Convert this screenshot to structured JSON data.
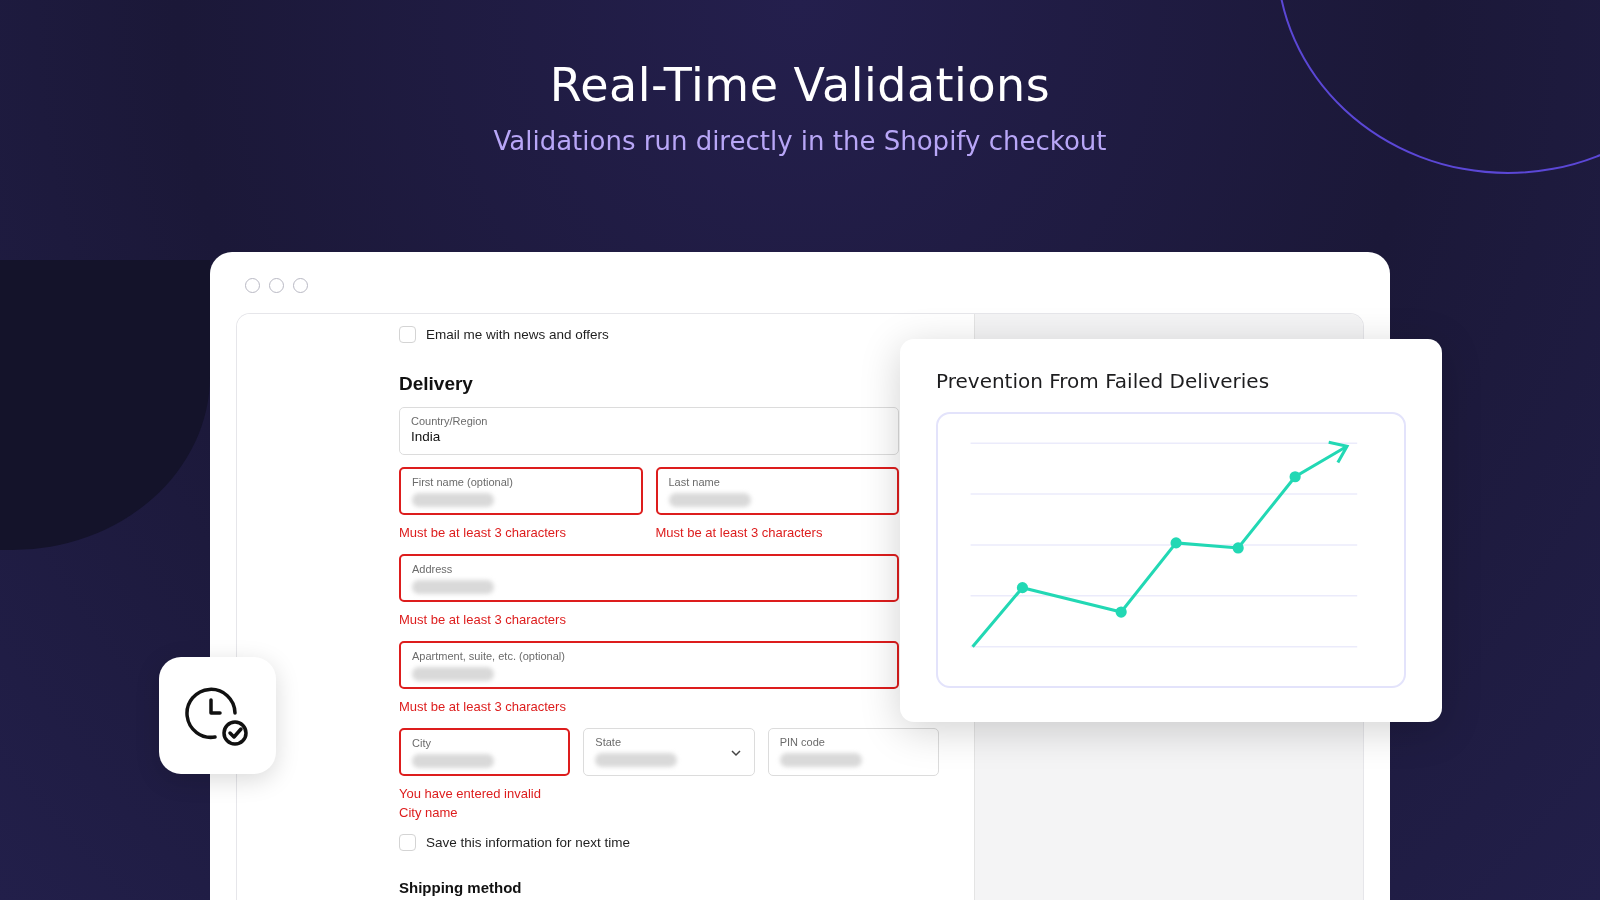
{
  "hero": {
    "title": "Real-Time Validations",
    "subtitle": "Validations run directly in the Shopify checkout"
  },
  "checkout": {
    "email_opt_in": {
      "label": "Email me with news and offers",
      "checked": false
    },
    "delivery": {
      "heading": "Delivery",
      "rows": [
        {
          "fields": [
            {
              "kind": "text",
              "label": "Country/Region",
              "value": "India",
              "obscured": false,
              "error": false
            }
          ]
        },
        {
          "fields": [
            {
              "kind": "text",
              "label": "First name (optional)",
              "obscured": true,
              "error": true,
              "message": "Must be at least 3 characters"
            },
            {
              "kind": "text",
              "label": "Last name",
              "obscured": true,
              "error": true,
              "message": "Must be at least 3 characters"
            }
          ]
        },
        {
          "fields": [
            {
              "kind": "text",
              "label": "Address",
              "obscured": true,
              "error": true,
              "message": "Must be at least 3 characters"
            }
          ]
        },
        {
          "fields": [
            {
              "kind": "text",
              "label": "Apartment, suite, etc. (optional)",
              "obscured": true,
              "error": true,
              "message": "Must be at least 3 characters"
            }
          ]
        },
        {
          "fields": [
            {
              "kind": "text",
              "label": "City",
              "obscured": true,
              "error": true,
              "message": "You have entered invalid City name"
            },
            {
              "kind": "select",
              "label": "State",
              "obscured": true,
              "error": false
            },
            {
              "kind": "text",
              "label": "PIN code",
              "obscured": true,
              "error": false
            }
          ]
        }
      ]
    },
    "save_info": {
      "label": "Save this information for next time",
      "checked": false
    },
    "shipping_heading": "Shipping method"
  },
  "chart_card": {
    "title": "Prevention From Failed Deliveries"
  }
}
